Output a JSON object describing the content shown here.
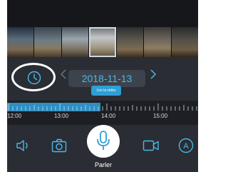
{
  "timeline_nav": {
    "date": "2018-11-13",
    "live_label": "Lire la vidéo",
    "prev_icon": "chevron-left-icon",
    "next_icon": "chevron-right-icon",
    "history_icon": "clock-icon"
  },
  "timeline": {
    "time_labels": [
      "12:00",
      "13:00",
      "14:00",
      "15:00"
    ],
    "recorded_color": "#2d8fc4"
  },
  "controls": {
    "talk_label": "Parler",
    "icons": [
      "speaker-icon",
      "camera-icon",
      "mic-icon",
      "video-icon",
      "auto-icon"
    ]
  },
  "colors": {
    "accent": "#4ab8e8",
    "background": "#2a2d34"
  }
}
